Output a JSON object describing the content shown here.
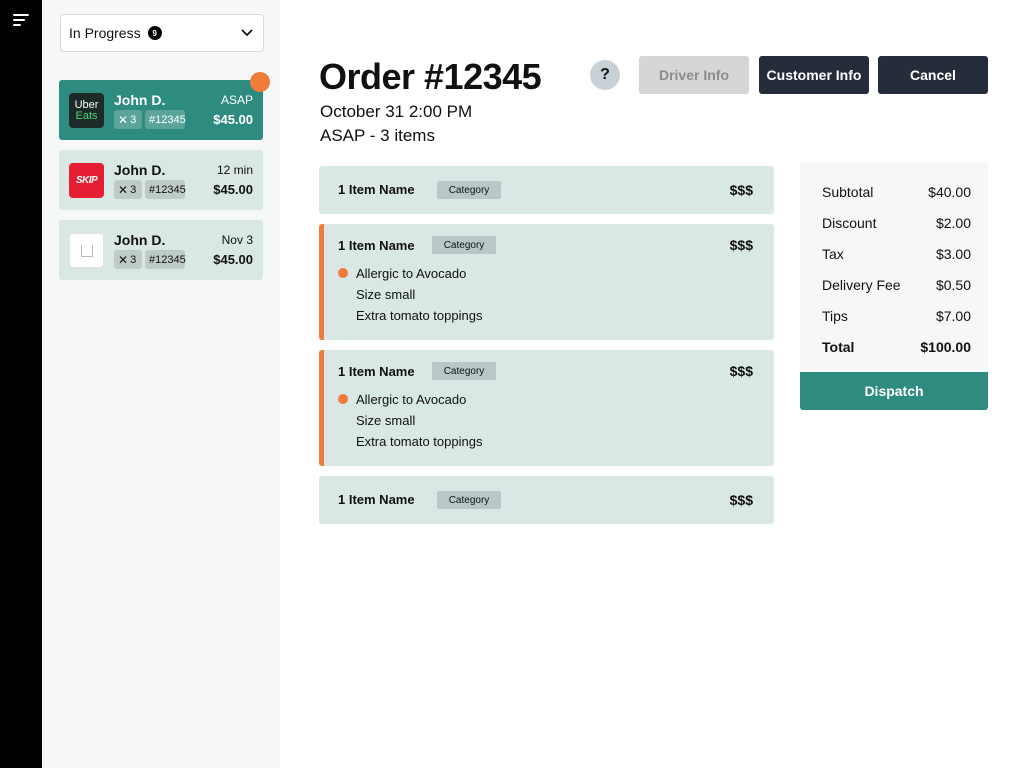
{
  "sidebar": {
    "status_filter": {
      "label": "In Progress",
      "count": "9"
    },
    "orders": [
      {
        "name": "John D.",
        "time": "ASAP",
        "qty": "3",
        "number": "#12345",
        "price": "$45.00",
        "platform_line1": "Uber",
        "platform_line2": "Eats"
      },
      {
        "name": "John D.",
        "time": "12 min",
        "qty": "3",
        "number": "#12345",
        "price": "$45.00",
        "platform_line1": "SKIP"
      },
      {
        "name": "John D.",
        "time": "Nov 3",
        "qty": "3",
        "number": "#12345",
        "price": "$45.00"
      }
    ]
  },
  "header": {
    "title": "Order #12345",
    "date": "October 31 2:00 PM",
    "summary": "ASAP - 3 items",
    "help_label": "?",
    "driver_label": "Driver Info",
    "customer_label": "Customer Info",
    "cancel_label": "Cancel"
  },
  "items": [
    {
      "name": "1 Item Name",
      "category": "Category",
      "price": "$$$"
    },
    {
      "name": "1 Item Name",
      "category": "Category",
      "price": "$$$",
      "mods": [
        "Allergic to Avocado",
        "Size small",
        "Extra tomato toppings"
      ]
    },
    {
      "name": "1 Item Name",
      "category": "Category",
      "price": "$$$",
      "mods": [
        "Allergic to Avocado",
        "Size small",
        "Extra tomato toppings"
      ]
    },
    {
      "name": "1 Item Name",
      "category": "Category",
      "price": "$$$"
    }
  ],
  "totals": {
    "rows": [
      {
        "label": "Subtotal",
        "value": "$40.00"
      },
      {
        "label": "Discount",
        "value": "$2.00"
      },
      {
        "label": "Tax",
        "value": "$3.00"
      },
      {
        "label": "Delivery Fee",
        "value": "$0.50"
      },
      {
        "label": "Tips",
        "value": "$7.00"
      },
      {
        "label": "Total",
        "value": "$100.00"
      }
    ],
    "dispatch_label": "Dispatch"
  },
  "colors": {
    "accent": "#2e8b7f",
    "card": "#d9e8e4",
    "dark_button": "#252d3a",
    "alert": "#ef7b3b"
  }
}
